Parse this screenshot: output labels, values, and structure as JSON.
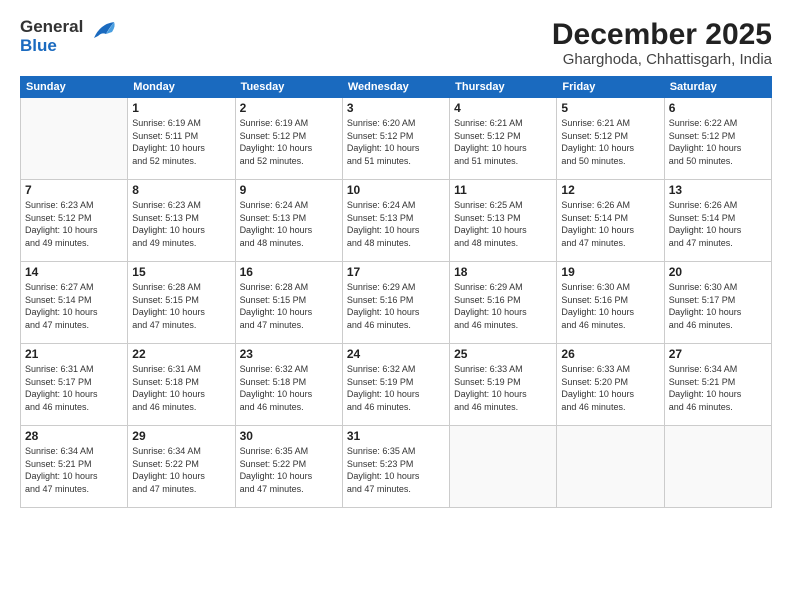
{
  "header": {
    "logo_general": "General",
    "logo_blue": "Blue",
    "month_title": "December 2025",
    "location": "Gharghoda, Chhattisgarh, India"
  },
  "days_of_week": [
    "Sunday",
    "Monday",
    "Tuesday",
    "Wednesday",
    "Thursday",
    "Friday",
    "Saturday"
  ],
  "weeks": [
    [
      {
        "day": "",
        "info": ""
      },
      {
        "day": "1",
        "info": "Sunrise: 6:19 AM\nSunset: 5:11 PM\nDaylight: 10 hours\nand 52 minutes."
      },
      {
        "day": "2",
        "info": "Sunrise: 6:19 AM\nSunset: 5:12 PM\nDaylight: 10 hours\nand 52 minutes."
      },
      {
        "day": "3",
        "info": "Sunrise: 6:20 AM\nSunset: 5:12 PM\nDaylight: 10 hours\nand 51 minutes."
      },
      {
        "day": "4",
        "info": "Sunrise: 6:21 AM\nSunset: 5:12 PM\nDaylight: 10 hours\nand 51 minutes."
      },
      {
        "day": "5",
        "info": "Sunrise: 6:21 AM\nSunset: 5:12 PM\nDaylight: 10 hours\nand 50 minutes."
      },
      {
        "day": "6",
        "info": "Sunrise: 6:22 AM\nSunset: 5:12 PM\nDaylight: 10 hours\nand 50 minutes."
      }
    ],
    [
      {
        "day": "7",
        "info": "Sunrise: 6:23 AM\nSunset: 5:12 PM\nDaylight: 10 hours\nand 49 minutes."
      },
      {
        "day": "8",
        "info": "Sunrise: 6:23 AM\nSunset: 5:13 PM\nDaylight: 10 hours\nand 49 minutes."
      },
      {
        "day": "9",
        "info": "Sunrise: 6:24 AM\nSunset: 5:13 PM\nDaylight: 10 hours\nand 48 minutes."
      },
      {
        "day": "10",
        "info": "Sunrise: 6:24 AM\nSunset: 5:13 PM\nDaylight: 10 hours\nand 48 minutes."
      },
      {
        "day": "11",
        "info": "Sunrise: 6:25 AM\nSunset: 5:13 PM\nDaylight: 10 hours\nand 48 minutes."
      },
      {
        "day": "12",
        "info": "Sunrise: 6:26 AM\nSunset: 5:14 PM\nDaylight: 10 hours\nand 47 minutes."
      },
      {
        "day": "13",
        "info": "Sunrise: 6:26 AM\nSunset: 5:14 PM\nDaylight: 10 hours\nand 47 minutes."
      }
    ],
    [
      {
        "day": "14",
        "info": "Sunrise: 6:27 AM\nSunset: 5:14 PM\nDaylight: 10 hours\nand 47 minutes."
      },
      {
        "day": "15",
        "info": "Sunrise: 6:28 AM\nSunset: 5:15 PM\nDaylight: 10 hours\nand 47 minutes."
      },
      {
        "day": "16",
        "info": "Sunrise: 6:28 AM\nSunset: 5:15 PM\nDaylight: 10 hours\nand 47 minutes."
      },
      {
        "day": "17",
        "info": "Sunrise: 6:29 AM\nSunset: 5:16 PM\nDaylight: 10 hours\nand 46 minutes."
      },
      {
        "day": "18",
        "info": "Sunrise: 6:29 AM\nSunset: 5:16 PM\nDaylight: 10 hours\nand 46 minutes."
      },
      {
        "day": "19",
        "info": "Sunrise: 6:30 AM\nSunset: 5:16 PM\nDaylight: 10 hours\nand 46 minutes."
      },
      {
        "day": "20",
        "info": "Sunrise: 6:30 AM\nSunset: 5:17 PM\nDaylight: 10 hours\nand 46 minutes."
      }
    ],
    [
      {
        "day": "21",
        "info": "Sunrise: 6:31 AM\nSunset: 5:17 PM\nDaylight: 10 hours\nand 46 minutes."
      },
      {
        "day": "22",
        "info": "Sunrise: 6:31 AM\nSunset: 5:18 PM\nDaylight: 10 hours\nand 46 minutes."
      },
      {
        "day": "23",
        "info": "Sunrise: 6:32 AM\nSunset: 5:18 PM\nDaylight: 10 hours\nand 46 minutes."
      },
      {
        "day": "24",
        "info": "Sunrise: 6:32 AM\nSunset: 5:19 PM\nDaylight: 10 hours\nand 46 minutes."
      },
      {
        "day": "25",
        "info": "Sunrise: 6:33 AM\nSunset: 5:19 PM\nDaylight: 10 hours\nand 46 minutes."
      },
      {
        "day": "26",
        "info": "Sunrise: 6:33 AM\nSunset: 5:20 PM\nDaylight: 10 hours\nand 46 minutes."
      },
      {
        "day": "27",
        "info": "Sunrise: 6:34 AM\nSunset: 5:21 PM\nDaylight: 10 hours\nand 46 minutes."
      }
    ],
    [
      {
        "day": "28",
        "info": "Sunrise: 6:34 AM\nSunset: 5:21 PM\nDaylight: 10 hours\nand 47 minutes."
      },
      {
        "day": "29",
        "info": "Sunrise: 6:34 AM\nSunset: 5:22 PM\nDaylight: 10 hours\nand 47 minutes."
      },
      {
        "day": "30",
        "info": "Sunrise: 6:35 AM\nSunset: 5:22 PM\nDaylight: 10 hours\nand 47 minutes."
      },
      {
        "day": "31",
        "info": "Sunrise: 6:35 AM\nSunset: 5:23 PM\nDaylight: 10 hours\nand 47 minutes."
      },
      {
        "day": "",
        "info": ""
      },
      {
        "day": "",
        "info": ""
      },
      {
        "day": "",
        "info": ""
      }
    ]
  ]
}
